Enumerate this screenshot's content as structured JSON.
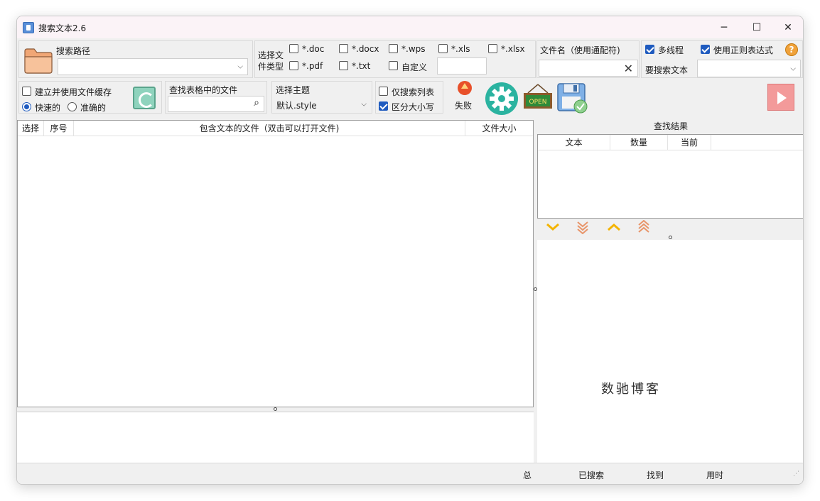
{
  "window": {
    "title": "搜索文本2.6",
    "minimize_glyph": "─",
    "maximize_glyph": "☐",
    "close_glyph": "✕"
  },
  "search_path": {
    "label": "搜索路径",
    "value": ""
  },
  "file_types": {
    "label_line1": "选择文",
    "label_line2": "件类型",
    "items": [
      {
        "label": "*.doc",
        "checked": false
      },
      {
        "label": "*.docx",
        "checked": false
      },
      {
        "label": "*.wps",
        "checked": false
      },
      {
        "label": "*.xls",
        "checked": false
      },
      {
        "label": "*.xlsx",
        "checked": false
      },
      {
        "label": "*.pdf",
        "checked": false
      },
      {
        "label": "*.txt",
        "checked": false
      },
      {
        "label": "自定义",
        "checked": false
      }
    ],
    "custom_value": ""
  },
  "filename": {
    "label": "文件名（使用通配符)",
    "value": ""
  },
  "options": {
    "multithread_label": "多线程",
    "multithread_checked": true,
    "regex_label": "使用正则表达式",
    "regex_checked": true,
    "search_text_label": "要搜索文本",
    "search_text_value": ""
  },
  "cache": {
    "label": "建立并使用文件缓存",
    "checked": false,
    "fast_label": "快速的",
    "fast_selected": true,
    "accurate_label": "准确的",
    "accurate_selected": false
  },
  "table_search": {
    "label": "查找表格中的文件",
    "value": ""
  },
  "theme": {
    "label": "选择主题",
    "value": "默认.style"
  },
  "list_options": {
    "search_list_only_label": "仅搜索列表",
    "search_list_only_checked": false,
    "case_sensitive_label": "区分大小写",
    "case_sensitive_checked": true
  },
  "fail": {
    "label": "失败"
  },
  "icons": {
    "open_sign_text": "OPEN"
  },
  "file_grid": {
    "columns": [
      "选择",
      "序号",
      "包含文本的文件（双击可以打开文件)",
      "文件大小"
    ]
  },
  "results": {
    "title": "查找结果",
    "columns": [
      "文本",
      "数量",
      "当前"
    ]
  },
  "watermark": "数驰博客",
  "status": {
    "total_label": "总",
    "searched_label": "已搜索",
    "found_label": "找到",
    "time_label": "用时"
  },
  "colors": {
    "accent": "#1f5bbf",
    "gear": "#2bb3a0",
    "play": "#f39a9a",
    "folder": "#f5b88a"
  }
}
